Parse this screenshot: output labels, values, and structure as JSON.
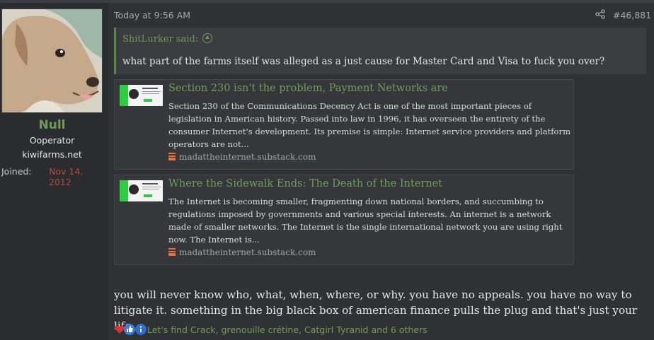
{
  "user": {
    "name": "Null",
    "title": "Ooperator",
    "site": "kiwifarms.net",
    "joined_label": "Joined:",
    "joined_value": "Nov 14, 2012"
  },
  "post": {
    "time": "Today at 9:56 AM",
    "number": "#46,881",
    "quote": {
      "author": "ShitLurker said:",
      "text": "what part of the farms itself was alleged as a just cause for Master Card and Visa to fuck you over?"
    },
    "embeds": [
      {
        "title": "Section 230 isn't the problem, Payment Networks are",
        "description": "Section 230 of the Communications Decency Act is one of the most important pieces of legislation in American history. Passed into law in 1996, it has overseen the entirety of the consumer Internet's development. Its premise is simple: Internet service providers and platform operators are not...",
        "source": "madattheinternet.substack.com"
      },
      {
        "title": "Where the Sidewalk Ends: The Death of the Internet",
        "description": "The Internet is becoming smaller, fragmenting down national borders, and succumbing to regulations imposed by governments and various special interests. An internet is a network made of smaller networks. The Internet is the single international network you are using right now. The Internet is...",
        "source": "madattheinternet.substack.com"
      }
    ],
    "body": "you will never know who, what, when, where, or why. you have no appeals. you have no way to litigate it. something in the big black box of american finance pulls the plug and that's just your life.",
    "reactions": {
      "icons": [
        "heart-icon",
        "thumbs-up-icon",
        "info-icon"
      ],
      "text": "Let's find Crack, grenouille crétine, Catgirl Tyranid and 6 others"
    }
  },
  "colors": {
    "accent_green": "#6e9c5a",
    "joined_red": "#b34a3d",
    "background": "#2f3134"
  }
}
